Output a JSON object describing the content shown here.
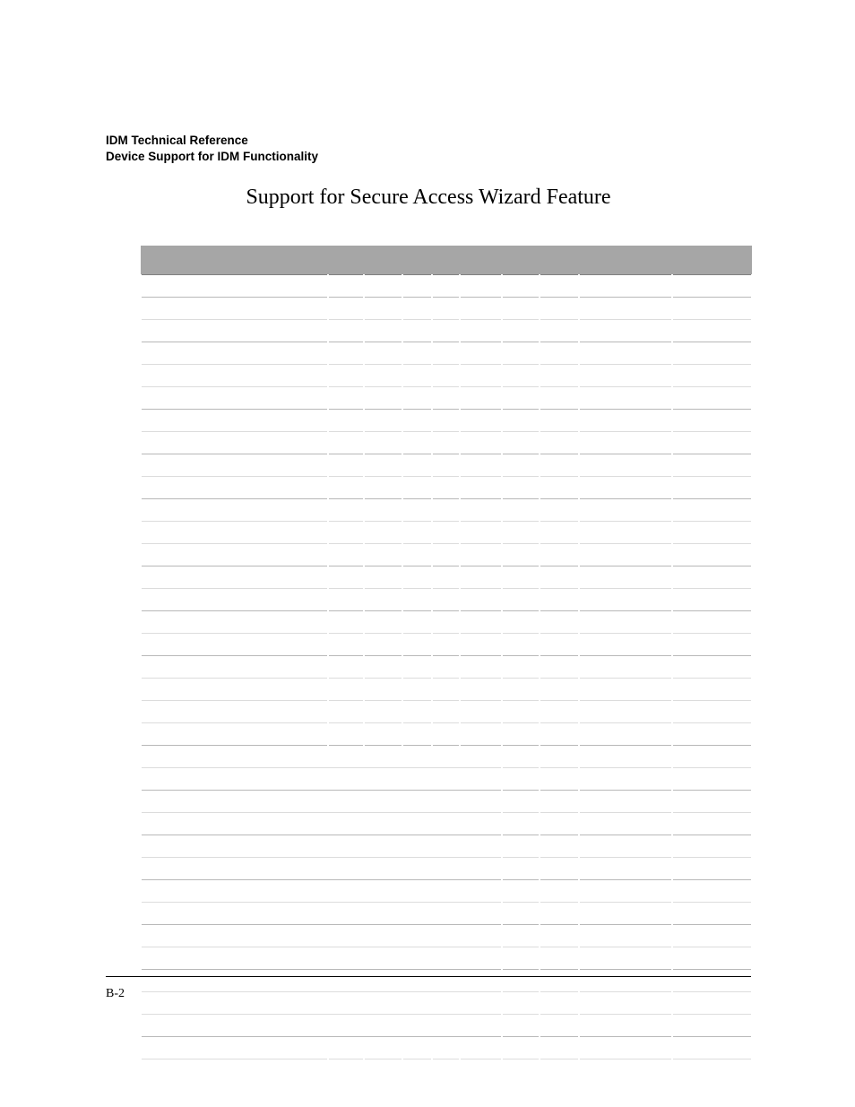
{
  "header": {
    "line1": "IDM Technical Reference",
    "line2": "Device Support for IDM Functionality"
  },
  "section_title": "Support for Secure Access Wizard Feature",
  "page_number": "B-2"
}
